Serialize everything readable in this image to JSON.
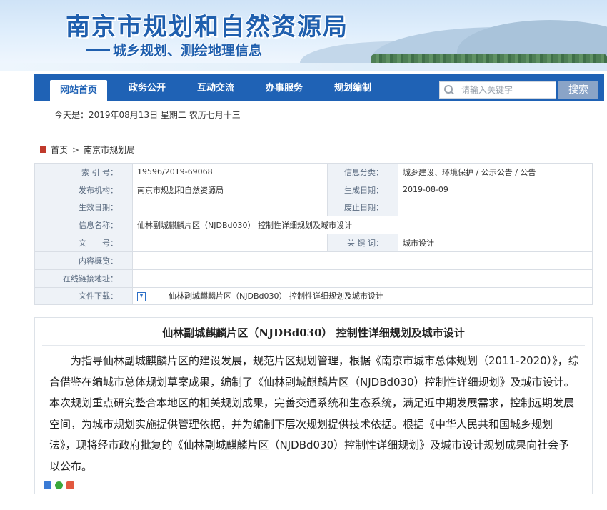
{
  "banner": {
    "title": "南京市规划和自然资源局",
    "subtitle": "城乡规划、测绘地理信息"
  },
  "nav": {
    "items": [
      "网站首页",
      "政务公开",
      "互动交流",
      "办事服务",
      "规划编制"
    ],
    "search_placeholder": "请输入关键字",
    "search_button": "搜索"
  },
  "date_line": "今天是：2019年08月13日 星期二   农历七月十三",
  "breadcrumb": [
    "首页",
    "南京市规划局"
  ],
  "info": {
    "index_label": "索 引 号：",
    "index_value": "19596/2019-69068",
    "category_label": "信息分类：",
    "category_value": "城乡建设、环境保护 / 公示公告 / 公告",
    "publisher_label": "发布机构：",
    "publisher_value": "南京市规划和自然资源局",
    "created_label": "生成日期：",
    "created_value": "2019-08-09",
    "effective_label": "生效日期：",
    "effective_value": "",
    "repealed_label": "废止日期：",
    "repealed_value": "",
    "name_label": "信息名称：",
    "name_value": "仙林副城麒麟片区（NJDBd030） 控制性详细规划及城市设计",
    "docno_label": "文　　号：",
    "docno_value": "",
    "keywords_label": "关 键 词：",
    "keywords_value": "城市设计",
    "summary_label": "内容概览：",
    "summary_value": "",
    "link_label": "在线链接地址：",
    "link_value": "",
    "download_label": "文件下载：",
    "download_value": "仙林副城麒麟片区（NJDBd030） 控制性详细规划及城市设计"
  },
  "article": {
    "title": "仙林副城麒麟片区（NJDBd030） 控制性详细规划及城市设计",
    "body": "为指导仙林副城麒麟片区的建设发展，规范片区规划管理，根据《南京市城市总体规划（2011-2020）》，综合借鉴在编城市总体规划草案成果，编制了《仙林副城麒麟片区（NJDBd030）控制性详细规划》及城市设计。本次规划重点研究整合本地区的相关规划成果，完善交通系统和生态系统，满足近中期发展需求，控制远期发展空间，为城市规划实施提供管理依据，并为编制下层次规划提供技术依据。根据《中华人民共和国城乡规划法》，现将经市政府批复的《仙林副城麒麟片区（NJDBd030）控制性详细规划》及城市设计规划成果向社会予以公布。"
  }
}
